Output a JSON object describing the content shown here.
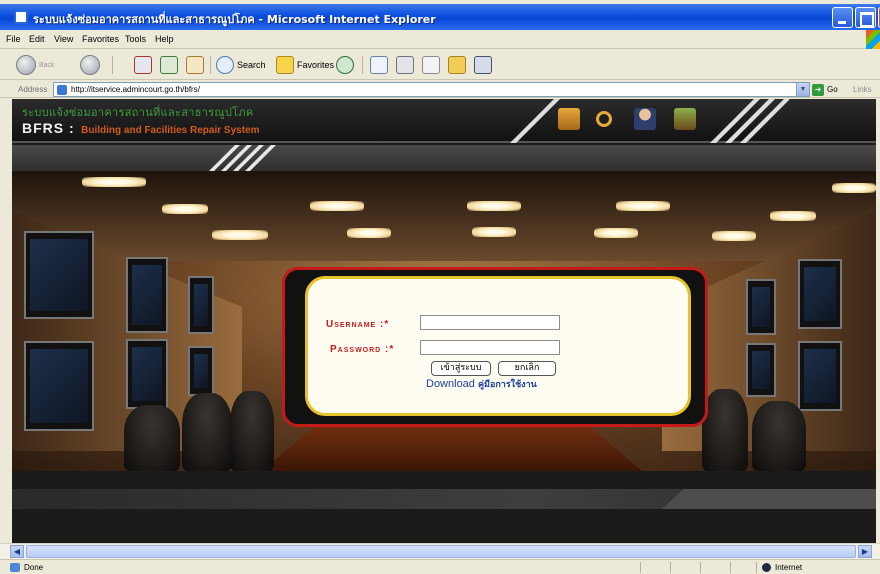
{
  "window": {
    "title": "ระบบแจ้งซ่อมอาคารสถานที่และสาธารณูปโภค - Microsoft Internet Explorer"
  },
  "menu": [
    "File",
    "Edit",
    "View",
    "Favorites",
    "Tools",
    "Help"
  ],
  "toolbar": {
    "back_label": "Back",
    "search_label": "Search",
    "favorites_label": "Favorites"
  },
  "address": {
    "label": "Address",
    "url": "http://itservice.admincourt.go.th/bfrs/",
    "go_label": "Go",
    "links_label": "Links"
  },
  "site": {
    "thai_title": "ระบบแจ้งซ่อมอาคารสถานที่และสาธารณูปโภค",
    "brand": "BFRS :",
    "brand_full": "Building and Facilities Repair System"
  },
  "login": {
    "username_label": "Username :*",
    "password_label": "Password :*",
    "username_value": "",
    "password_value": "",
    "submit_label": "เข้าสู่ระบบ",
    "cancel_label": "ยกเลิก",
    "download_label": "Download",
    "download_thai": "คู่มือการใช้งาน"
  },
  "status": {
    "text": "Done",
    "zone": "Internet"
  },
  "colors": {
    "xp_blue": "#0a4ee0",
    "login_border": "#c41a1a",
    "card_border": "#e6c32a",
    "label_red": "#c41a1a",
    "link_blue": "#1c3f9e"
  }
}
